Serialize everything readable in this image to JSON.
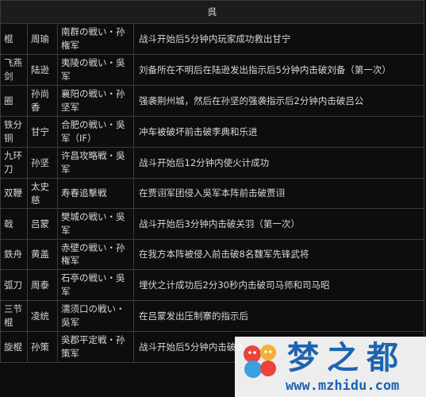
{
  "header": {
    "title": "呉"
  },
  "rows": [
    {
      "weapon": "棍",
      "general": "周瑜",
      "battle": "南群の戦い・孙権军",
      "condition": "战斗开始后5分钟内玩家成功救出甘宁"
    },
    {
      "weapon": "飞燕剑",
      "general": "陆逊",
      "battle": "夷陵の戦い・吳军",
      "condition": "刘备所在不明后在陆逊发出指示后5分钟内击破刘备（第一次）"
    },
    {
      "weapon": "圈",
      "general": "孙尚香",
      "battle": "襄阳の戦い・孙坚军",
      "condition": "强袭荆州城，然后在孙坚的强袭指示后2分钟内击破吕公"
    },
    {
      "weapon": "铁分铜",
      "general": "甘宁",
      "battle": "合肥の戦い・吳军（IF）",
      "condition": "冲车被破坏前击破李典和乐进"
    },
    {
      "weapon": "九环刀",
      "general": "孙坚",
      "battle": "许昌攻略戦・吳军",
      "condition": "战斗开始后12分钟内使火计成功"
    },
    {
      "weapon": "双鞭",
      "general": "太史慈",
      "battle": "寿春追撃戦",
      "condition": "在贾诩军团侵入吳军本阵前击破贾诩"
    },
    {
      "weapon": "戟",
      "general": "吕蒙",
      "battle": "樊城の戦い・吳军",
      "condition": "战斗开始后3分钟内击破关羽（第一次）"
    },
    {
      "weapon": "鉄舟",
      "general": "黄盖",
      "battle": "赤壁の戦い・孙権军",
      "condition": "在我方本阵被侵入前击破8名魏军先锋武将"
    },
    {
      "weapon": "弧刀",
      "general": "周泰",
      "battle": "石亭の戦い・吳军",
      "condition": "埋伏之计成功后2分30秒内击破司马师和司马昭"
    },
    {
      "weapon": "三节棍",
      "general": "凌统",
      "battle": "濡须口の戦い・吳军",
      "condition": "在吕蒙发出压制寨的指示后"
    },
    {
      "weapon": "旋棍",
      "general": "孙策",
      "battle": "吳郡平定戦・孙策军",
      "condition": "战斗开始后5分钟内击破太"
    }
  ],
  "watermark": {
    "brand": "梦之都",
    "url": "www.mzhidu.com"
  },
  "colors": {
    "background": "#0d0d0d",
    "text": "#d8d8d8",
    "border": "#3a3a3a",
    "watermark": "#1d64b0"
  }
}
